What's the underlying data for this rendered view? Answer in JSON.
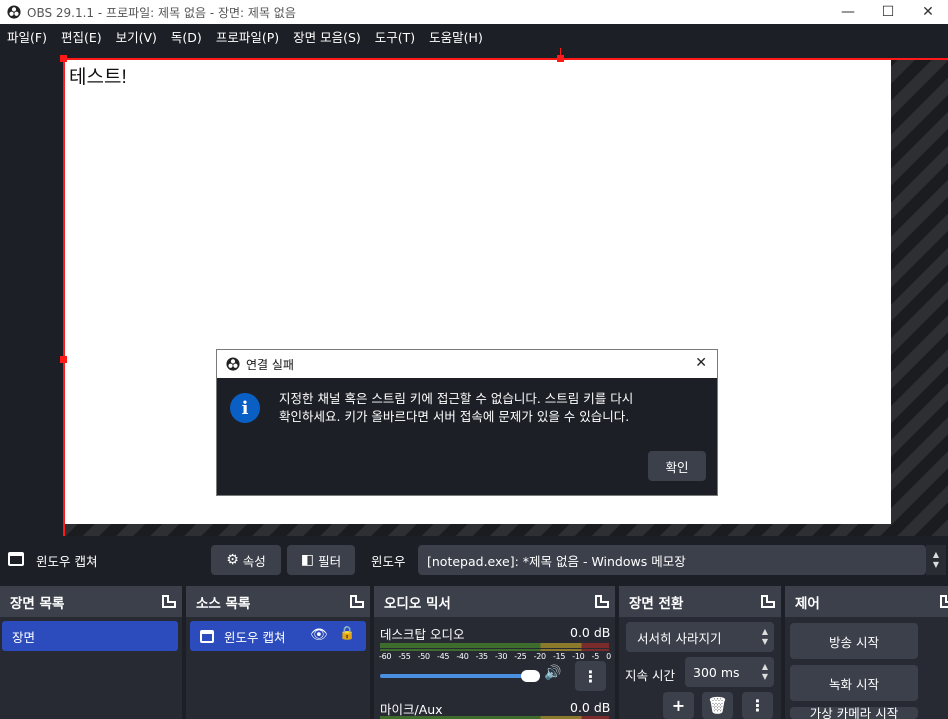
{
  "window": {
    "title": "OBS 29.1.1 - 프로파일: 제목 없음 - 장면: 제목 없음",
    "minimize": "—",
    "maximize": "☐",
    "close": "✕"
  },
  "menu": [
    "파일(F)",
    "편집(E)",
    "보기(V)",
    "독(D)",
    "프로파일(P)",
    "장면 모음(S)",
    "도구(T)",
    "도움말(H)"
  ],
  "preview": {
    "canvas_text": "테스트!"
  },
  "dialog": {
    "title": "연결 실패",
    "close": "✕",
    "info_glyph": "i",
    "message_line1": "지정한 채널 혹은 스트림 키에 접근할 수 없습니다. 스트림 키를 다시",
    "message_line2": "확인하세요. 키가 올바르다면 서버 접속에 문제가 있을 수 있습니다.",
    "ok_label": "확인"
  },
  "source_toolbar": {
    "source_name": "윈도우 캡쳐",
    "properties_label": "속성",
    "filters_label": "필터",
    "window_label": "윈도우",
    "window_value": "[notepad.exe]: *제목 없음 - Windows 메모장"
  },
  "docks": {
    "scenes": {
      "title": "장면 목록",
      "items": [
        "장면"
      ]
    },
    "sources": {
      "title": "소스 목록",
      "items": [
        "윈도우 캡쳐"
      ]
    },
    "mixer": {
      "title": "오디오 믹서",
      "channels": [
        {
          "name": "데스크탑 오디오",
          "level": "0.0 dB"
        },
        {
          "name": "마이크/Aux",
          "level": "0.0 dB"
        }
      ],
      "scale": [
        "-60",
        "-55",
        "-50",
        "-45",
        "-40",
        "-35",
        "-30",
        "-25",
        "-20",
        "-15",
        "-10",
        "-5",
        "0"
      ]
    },
    "transitions": {
      "title": "장면 전환",
      "selected": "서서히 사라지기",
      "duration_label": "지속 시간",
      "duration_value": "300 ms"
    },
    "controls": {
      "title": "제어",
      "start_streaming": "방송 시작",
      "start_recording": "녹화 시작",
      "virtual_camera": "가상 카메라 시작"
    }
  },
  "colors": {
    "accent": "#2c4cbd",
    "selection": "#ff1a1a",
    "panel": "#272a33",
    "header": "#3c404b"
  }
}
